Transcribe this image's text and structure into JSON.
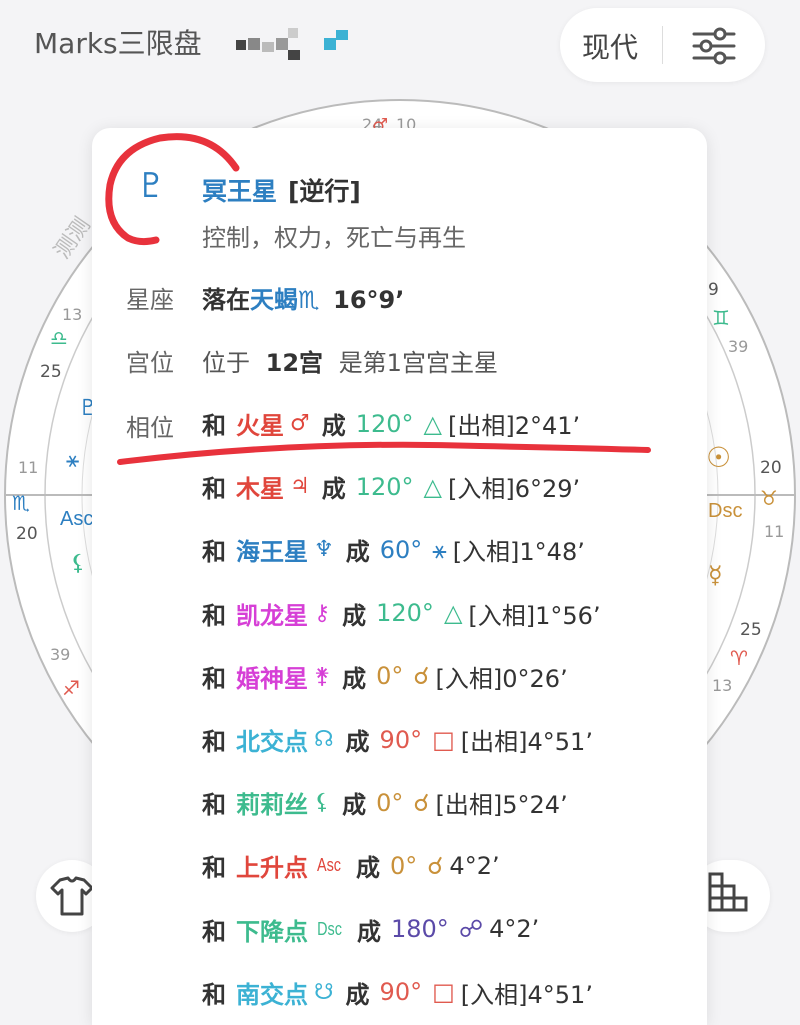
{
  "header": {
    "app_title": "Marks三限盘",
    "mode_label": "现代"
  },
  "colors": {
    "pluto_blue": "#2d7fc1",
    "annotation_red": "#e8323c",
    "trine_green": "#3dbb8e",
    "sextile_blue": "#2d7fc1",
    "conjunction_tan": "#c9913a",
    "square_red": "#e05a4f",
    "opposition_purple": "#5b4aa8"
  },
  "wheel": {
    "tick_labels": [
      "24",
      "10",
      "9",
      "39",
      "13",
      "25",
      "11",
      "20",
      "20",
      "11",
      "25",
      "39",
      "13"
    ],
    "side_labels": [
      "Asc",
      "Dsc"
    ],
    "rotated_text": "测测"
  },
  "planet": {
    "symbol": "♇",
    "symbol_icon": "pluto-glyph",
    "name": "冥王星",
    "status": "[逆行]",
    "keywords": "控制，权力，死亡与再生"
  },
  "sign_row": {
    "label": "星座",
    "prefix": "落在",
    "sign": "天蝎",
    "sign_symbol": "♏",
    "degree": "16°9’"
  },
  "house_row": {
    "label": "宫位",
    "prefix": "位于",
    "house": "12宫",
    "suffix": "是第1宫宫主星"
  },
  "aspects": {
    "label": "相位",
    "he": "和",
    "cheng": "成",
    "items": [
      {
        "planet": "火星",
        "planet_symbol": "♂",
        "planet_color": "#e0463c",
        "angle": "120°",
        "aspect_symbol": "△",
        "aspect_color": "#3dbb8e",
        "detail": "[出相]2°41’"
      },
      {
        "planet": "木星",
        "planet_symbol": "♃",
        "planet_color": "#e0463c",
        "angle": "120°",
        "aspect_symbol": "△",
        "aspect_color": "#3dbb8e",
        "detail": "[入相]6°29’"
      },
      {
        "planet": "海王星",
        "planet_symbol": "♆",
        "planet_color": "#2d7fc1",
        "angle": "60°",
        "aspect_symbol": "⚹",
        "aspect_color": "#2d7fc1",
        "detail": "[入相]1°48’"
      },
      {
        "planet": "凯龙星",
        "planet_symbol": "⚷",
        "planet_color": "#d63fd6",
        "angle": "120°",
        "aspect_symbol": "△",
        "aspect_color": "#3dbb8e",
        "detail": "[入相]1°56’"
      },
      {
        "planet": "婚神星",
        "planet_symbol": "⚵",
        "planet_color": "#d63fd6",
        "angle": "0°",
        "aspect_symbol": "☌",
        "aspect_color": "#c9913a",
        "detail": "[入相]0°26’"
      },
      {
        "planet": "北交点",
        "planet_symbol": "☊",
        "planet_color": "#3cb2d4",
        "angle": "90°",
        "aspect_symbol": "□",
        "aspect_color": "#e05a4f",
        "detail": "[出相]4°51’"
      },
      {
        "planet": "莉莉丝",
        "planet_symbol": "⚸",
        "planet_color": "#3dbb8e",
        "angle": "0°",
        "aspect_symbol": "☌",
        "aspect_color": "#c9913a",
        "detail": "[出相]5°24’"
      },
      {
        "planet": "上升点",
        "planet_symbol": "Asc",
        "planet_color": "#e0463c",
        "angle": "0°",
        "aspect_symbol": "☌",
        "aspect_color": "#c9913a",
        "detail": "4°2’"
      },
      {
        "planet": "下降点",
        "planet_symbol": "Dsc",
        "planet_color": "#3dbb8e",
        "angle": "180°",
        "aspect_symbol": "☍",
        "aspect_color": "#5b4aa8",
        "detail": "4°2’"
      },
      {
        "planet": "南交点",
        "planet_symbol": "☋",
        "planet_color": "#3cb2d4",
        "angle": "90°",
        "aspect_symbol": "□",
        "aspect_color": "#e05a4f",
        "detail": "[入相]4°51’"
      }
    ]
  }
}
